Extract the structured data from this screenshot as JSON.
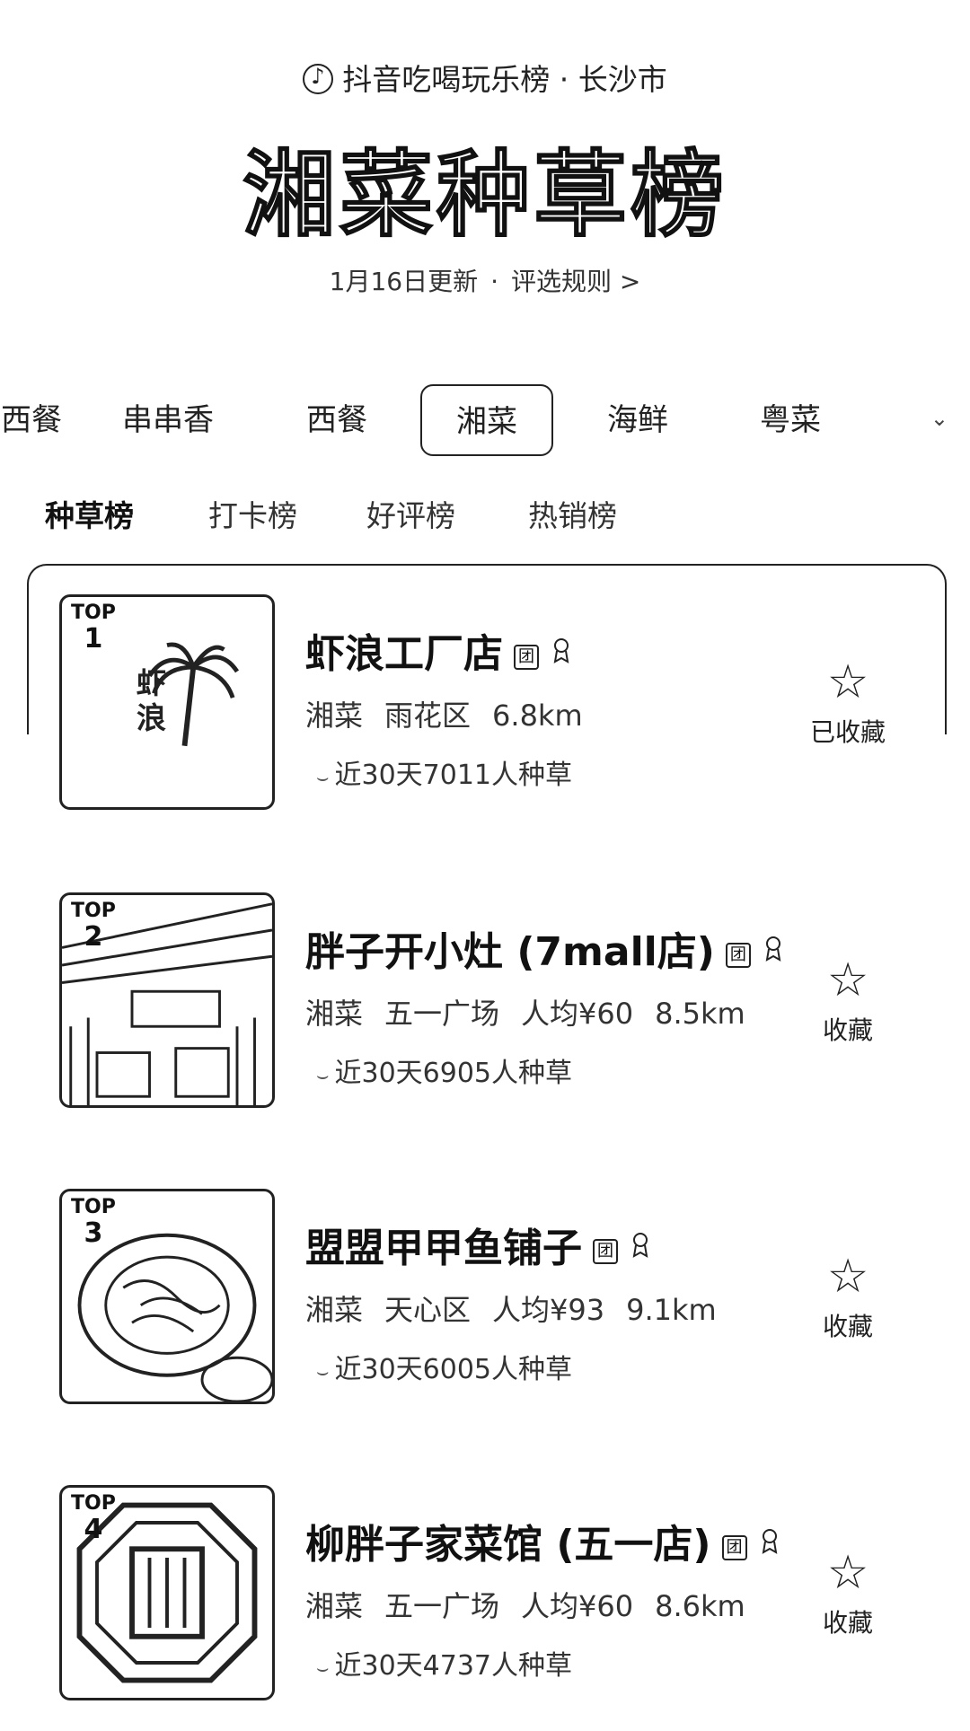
{
  "header": {
    "subtitle": "抖音吃喝玩乐榜 · 长沙市",
    "title": "湘菜种草榜",
    "update_text": "1月16日更新",
    "rules_text": "评选规则 >"
  },
  "category_tabs": [
    "西餐",
    "串串香",
    "西餐",
    "湘菜",
    "海鲜",
    "粤菜"
  ],
  "category_active_index": 3,
  "category_more_icon": "chevron-down-icon",
  "sub_tabs": [
    "种草榜",
    "打卡榜",
    "好评榜",
    "热销榜"
  ],
  "sub_active_index": 0,
  "items": [
    {
      "rank_label": "TOP",
      "rank": "1",
      "name": "虾浪工厂店",
      "tuan": "团",
      "cuisine": "湘菜",
      "area": "雨花区",
      "price": "",
      "distance": "6.8km",
      "grass_text": "近30天7011人种草",
      "fav_label": "已收藏",
      "thumb_text": "虾浪"
    },
    {
      "rank_label": "TOP",
      "rank": "2",
      "name": "胖子开小灶 (7mall店)",
      "tuan": "团",
      "cuisine": "湘菜",
      "area": "五一广场",
      "price": "人均¥60",
      "distance": "8.5km",
      "grass_text": "近30天6905人种草",
      "fav_label": "收藏",
      "thumb_text": ""
    },
    {
      "rank_label": "TOP",
      "rank": "3",
      "name": "盟盟甲甲鱼铺子",
      "tuan": "团",
      "cuisine": "湘菜",
      "area": "天心区",
      "price": "人均¥93",
      "distance": "9.1km",
      "grass_text": "近30天6005人种草",
      "fav_label": "收藏",
      "thumb_text": ""
    },
    {
      "rank_label": "TOP",
      "rank": "4",
      "name": "柳胖子家菜馆 (五一店)",
      "tuan": "团",
      "cuisine": "湘菜",
      "area": "五一广场",
      "price": "人均¥60",
      "distance": "8.6km",
      "grass_text": "近30天4737人种草",
      "fav_label": "收藏",
      "thumb_text": ""
    }
  ]
}
